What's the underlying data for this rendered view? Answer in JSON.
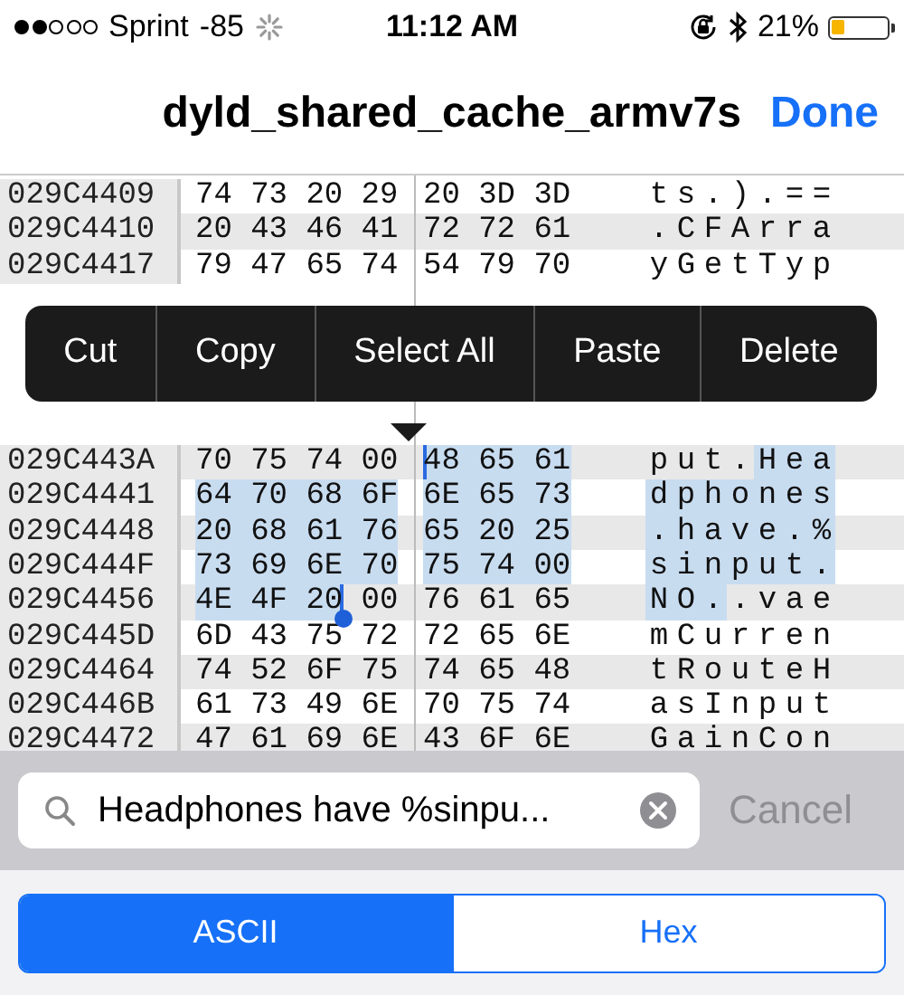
{
  "status_bar": {
    "signal_dots": [
      {
        "filled": true
      },
      {
        "filled": true
      },
      {
        "filled": false
      },
      {
        "filled": false
      },
      {
        "filled": false
      }
    ],
    "carrier": "Sprint",
    "signal_strength": "-85",
    "time": "11:12 AM",
    "battery_percent": "21%",
    "battery": {
      "level": 0.21
    }
  },
  "nav_bar": {
    "title": "dyld_shared_cache_armv7s",
    "done": "Done"
  },
  "hex_rows": [
    {
      "kind": "row",
      "address": "029C4409",
      "shaded": false,
      "bytes": [
        {
          "hex": "74",
          "char": "t",
          "selected": false
        },
        {
          "hex": "73",
          "char": "s",
          "selected": false
        },
        {
          "hex": "20",
          "char": ".",
          "selected": false
        },
        {
          "hex": "29",
          "char": ")",
          "selected": false
        },
        {
          "hex": "20",
          "char": ".",
          "selected": false
        },
        {
          "hex": "3D",
          "char": "=",
          "selected": false
        },
        {
          "hex": "3D",
          "char": "=",
          "selected": false
        }
      ]
    },
    {
      "kind": "row",
      "address": "029C4410",
      "shaded": true,
      "bytes": [
        {
          "hex": "20",
          "char": ".",
          "selected": false
        },
        {
          "hex": "43",
          "char": "C",
          "selected": false
        },
        {
          "hex": "46",
          "char": "F",
          "selected": false
        },
        {
          "hex": "41",
          "char": "A",
          "selected": false
        },
        {
          "hex": "72",
          "char": "r",
          "selected": false
        },
        {
          "hex": "72",
          "char": "r",
          "selected": false
        },
        {
          "hex": "61",
          "char": "a",
          "selected": false
        }
      ]
    },
    {
      "kind": "row",
      "address": "029C4417",
      "shaded": false,
      "bytes": [
        {
          "hex": "79",
          "char": "y",
          "selected": false
        },
        {
          "hex": "47",
          "char": "G",
          "selected": false
        },
        {
          "hex": "65",
          "char": "e",
          "selected": false
        },
        {
          "hex": "74",
          "char": "t",
          "selected": false
        },
        {
          "hex": "54",
          "char": "T",
          "selected": false
        },
        {
          "hex": "79",
          "char": "y",
          "selected": false
        },
        {
          "hex": "70",
          "char": "p",
          "selected": false
        }
      ]
    },
    {
      "kind": "menu",
      "items": [
        "Cut",
        "Copy",
        "Select All",
        "Paste",
        "Delete"
      ]
    },
    {
      "kind": "row",
      "address": "029C443A",
      "shaded": true,
      "bytes": [
        {
          "hex": "70",
          "char": "p",
          "selected": false
        },
        {
          "hex": "75",
          "char": "u",
          "selected": false
        },
        {
          "hex": "74",
          "char": "t",
          "selected": false
        },
        {
          "hex": "00",
          "char": ".",
          "selected": false
        },
        {
          "hex": "48",
          "char": "H",
          "selected": true
        },
        {
          "hex": "65",
          "char": "e",
          "selected": true
        },
        {
          "hex": "61",
          "char": "a",
          "selected": true
        }
      ]
    },
    {
      "kind": "row",
      "address": "029C4441",
      "shaded": false,
      "bytes": [
        {
          "hex": "64",
          "char": "d",
          "selected": true
        },
        {
          "hex": "70",
          "char": "p",
          "selected": true
        },
        {
          "hex": "68",
          "char": "h",
          "selected": true
        },
        {
          "hex": "6F",
          "char": "o",
          "selected": true
        },
        {
          "hex": "6E",
          "char": "n",
          "selected": true
        },
        {
          "hex": "65",
          "char": "e",
          "selected": true
        },
        {
          "hex": "73",
          "char": "s",
          "selected": true
        }
      ]
    },
    {
      "kind": "row",
      "address": "029C4448",
      "shaded": true,
      "bytes": [
        {
          "hex": "20",
          "char": ".",
          "selected": true
        },
        {
          "hex": "68",
          "char": "h",
          "selected": true
        },
        {
          "hex": "61",
          "char": "a",
          "selected": true
        },
        {
          "hex": "76",
          "char": "v",
          "selected": true
        },
        {
          "hex": "65",
          "char": "e",
          "selected": true
        },
        {
          "hex": "20",
          "char": ".",
          "selected": true
        },
        {
          "hex": "25",
          "char": "%",
          "selected": true
        }
      ]
    },
    {
      "kind": "row",
      "address": "029C444F",
      "shaded": false,
      "bytes": [
        {
          "hex": "73",
          "char": "s",
          "selected": true
        },
        {
          "hex": "69",
          "char": "i",
          "selected": true
        },
        {
          "hex": "6E",
          "char": "n",
          "selected": true
        },
        {
          "hex": "70",
          "char": "p",
          "selected": true
        },
        {
          "hex": "75",
          "char": "u",
          "selected": true
        },
        {
          "hex": "74",
          "char": "t",
          "selected": true
        },
        {
          "hex": "00",
          "char": ".",
          "selected": true
        }
      ]
    },
    {
      "kind": "row",
      "address": "029C4456",
      "shaded": true,
      "bytes": [
        {
          "hex": "4E",
          "char": "N",
          "selected": true
        },
        {
          "hex": "4F",
          "char": "O",
          "selected": true
        },
        {
          "hex": "20",
          "char": ".",
          "selected": true
        },
        {
          "hex": "00",
          "char": ".",
          "selected": false
        },
        {
          "hex": "76",
          "char": "v",
          "selected": false
        },
        {
          "hex": "61",
          "char": "a",
          "selected": false
        },
        {
          "hex": "65",
          "char": "e",
          "selected": false
        }
      ]
    },
    {
      "kind": "row",
      "address": "029C445D",
      "shaded": false,
      "bytes": [
        {
          "hex": "6D",
          "char": "m",
          "selected": false
        },
        {
          "hex": "43",
          "char": "C",
          "selected": false
        },
        {
          "hex": "75",
          "char": "u",
          "selected": false
        },
        {
          "hex": "72",
          "char": "r",
          "selected": false
        },
        {
          "hex": "72",
          "char": "r",
          "selected": false
        },
        {
          "hex": "65",
          "char": "e",
          "selected": false
        },
        {
          "hex": "6E",
          "char": "n",
          "selected": false
        }
      ]
    },
    {
      "kind": "row",
      "address": "029C4464",
      "shaded": true,
      "bytes": [
        {
          "hex": "74",
          "char": "t",
          "selected": false
        },
        {
          "hex": "52",
          "char": "R",
          "selected": false
        },
        {
          "hex": "6F",
          "char": "o",
          "selected": false
        },
        {
          "hex": "75",
          "char": "u",
          "selected": false
        },
        {
          "hex": "74",
          "char": "t",
          "selected": false
        },
        {
          "hex": "65",
          "char": "e",
          "selected": false
        },
        {
          "hex": "48",
          "char": "H",
          "selected": false
        }
      ]
    },
    {
      "kind": "row",
      "address": "029C446B",
      "shaded": false,
      "bytes": [
        {
          "hex": "61",
          "char": "a",
          "selected": false
        },
        {
          "hex": "73",
          "char": "s",
          "selected": false
        },
        {
          "hex": "49",
          "char": "I",
          "selected": false
        },
        {
          "hex": "6E",
          "char": "n",
          "selected": false
        },
        {
          "hex": "70",
          "char": "p",
          "selected": false
        },
        {
          "hex": "75",
          "char": "u",
          "selected": false
        },
        {
          "hex": "74",
          "char": "t",
          "selected": false
        }
      ]
    },
    {
      "kind": "row",
      "address": "029C4472",
      "shaded": true,
      "bytes": [
        {
          "hex": "47",
          "char": "G",
          "selected": false
        },
        {
          "hex": "61",
          "char": "a",
          "selected": false
        },
        {
          "hex": "69",
          "char": "i",
          "selected": false
        },
        {
          "hex": "6E",
          "char": "n",
          "selected": false
        },
        {
          "hex": "43",
          "char": "C",
          "selected": false
        },
        {
          "hex": "6F",
          "char": "o",
          "selected": false
        },
        {
          "hex": "6E",
          "char": "n",
          "selected": false
        }
      ]
    }
  ],
  "search": {
    "value": "Headphones have %sinpu...",
    "cancel": "Cancel",
    "cancel_disabled": true
  },
  "segments": [
    {
      "label": "ASCII",
      "selected": true
    },
    {
      "label": "Hex",
      "selected": false
    }
  ]
}
